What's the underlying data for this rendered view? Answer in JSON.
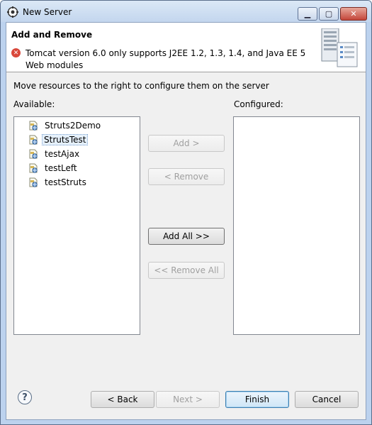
{
  "window": {
    "title": "New Server",
    "controls": {
      "minimize": "▁",
      "maximize": "▢",
      "close": "✕"
    }
  },
  "header": {
    "title": "Add and Remove",
    "message": "Tomcat version 6.0 only supports J2EE 1.2, 1.3, 1.4, and Java EE 5 Web modules"
  },
  "instruction": "Move resources to the right to configure them on the server",
  "available": {
    "label": "Available:",
    "items": [
      {
        "label": "Struts2Demo",
        "selected": false
      },
      {
        "label": "StrutsTest",
        "selected": true
      },
      {
        "label": "testAjax",
        "selected": false
      },
      {
        "label": "testLeft",
        "selected": false
      },
      {
        "label": "testStruts",
        "selected": false
      }
    ]
  },
  "configured": {
    "label": "Configured:",
    "items": []
  },
  "actions": {
    "add": "Add >",
    "remove": "< Remove",
    "add_all": "Add All >>",
    "remove_all": "<< Remove All"
  },
  "footer": {
    "help": "?",
    "back": "< Back",
    "next": "Next >",
    "finish": "Finish",
    "cancel": "Cancel"
  }
}
